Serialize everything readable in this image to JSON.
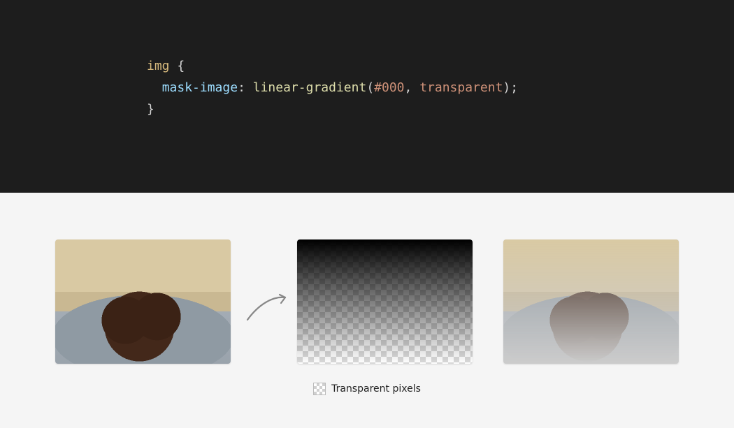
{
  "code": {
    "selector": "img",
    "open_brace": "{",
    "indent": "  ",
    "property": "mask-image",
    "colon": ":",
    "space": " ",
    "func": "linear-gradient",
    "open_paren": "(",
    "arg1": "#000",
    "comma": ",",
    "arg2": "transparent",
    "close_paren": ")",
    "semicolon": ";",
    "close_brace": "}"
  },
  "legend": {
    "label": "Transparent pixels"
  }
}
